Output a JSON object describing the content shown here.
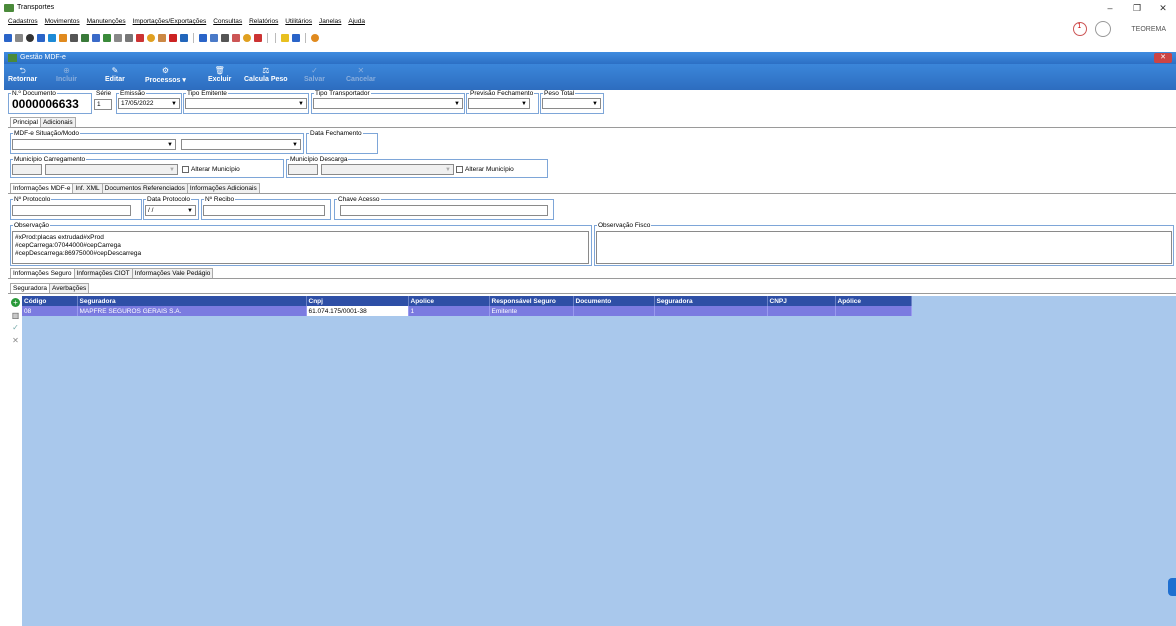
{
  "window": {
    "title": "Transportes",
    "min": "–",
    "restore": "❐",
    "close": "✕"
  },
  "menu": [
    "Cadastros",
    "Movimentos",
    "Manutenções",
    "Importações/Exportações",
    "Consultas",
    "Relatórios",
    "Utilitários",
    "Janelas",
    "Ajuda"
  ],
  "user": {
    "name": "TEOREMA",
    "notifications": "1"
  },
  "form": {
    "title": "Gestão MDF-e",
    "close": "✕",
    "commands": [
      {
        "label": "Retornar",
        "glyph": "⮌",
        "enabled": true
      },
      {
        "label": "Incluir",
        "glyph": "⊕",
        "enabled": false
      },
      {
        "label": "Editar",
        "glyph": "✎",
        "enabled": true
      },
      {
        "label": "Processos",
        "glyph": "⚙",
        "enabled": true
      },
      {
        "label": "Excluir",
        "glyph": "🗑",
        "enabled": true
      },
      {
        "label": "Calcula Peso",
        "glyph": "⚖",
        "enabled": true
      },
      {
        "label": "Salvar",
        "glyph": "✓",
        "enabled": false
      },
      {
        "label": "Cancelar",
        "glyph": "✕",
        "enabled": false
      }
    ]
  },
  "fields": {
    "num_doc_label": "N.º Documento",
    "num_doc": "0000006633",
    "serie_label": "Série",
    "serie": "1",
    "emissao_label": "Emissão",
    "emissao": "17/05/2022",
    "tipo_emitente_label": "Tipo Emitente",
    "tipo_transportador_label": "Tipo Transportador",
    "previsao_label": "Previsão Fechamento",
    "peso_label": "Peso Total"
  },
  "tabs_main": [
    "Principal",
    "Adicionais"
  ],
  "principal": {
    "situacao_label": "MDF-e Situação/Modo",
    "data_fechamento_label": "Data Fechamento",
    "mun_carregamento_label": "Município Carregamento",
    "mun_descarga_label": "Município Descarga",
    "alterar_municipio": "Alterar Município"
  },
  "tabs_info": [
    "Informações MDF-e",
    "Inf. XML",
    "Documentos Referenciados",
    "Informações Adicionais"
  ],
  "info": {
    "protocolo_label": "Nº Protocolo",
    "data_protocolo_label": "Data Protocolo",
    "data_protocolo": " / /",
    "recibo_label": "Nº Recibo",
    "chave_label": "Chave Acesso",
    "observacao_label": "Observação",
    "observacao_lines": [
      "#xProd:placas extrudad#xProd",
      "#cepCarrega:07044000#cepCarrega",
      "#cepDescarrega:86975000#cepDescarrega"
    ],
    "obs_fisco_label": "Observação Fisco"
  },
  "tabs_extra": [
    "Informações Seguro",
    "Informações CIOT",
    "Informações Vale Pedágio"
  ],
  "tabs_seguro": [
    "Seguradora",
    "Averbações"
  ],
  "grid": {
    "columns": [
      {
        "label": "Código"
      },
      {
        "label": "Seguradora"
      },
      {
        "label": "Cnpj"
      },
      {
        "label": "Apolice"
      },
      {
        "label": "Responsável Seguro"
      },
      {
        "label": "Documento"
      },
      {
        "label": "Seguradora"
      },
      {
        "label": "CNPJ"
      },
      {
        "label": "Apólice"
      }
    ],
    "rows": [
      [
        "08",
        "MAPFRE SEGUROS GERAIS S.A.",
        "61.074.175/0001-38",
        "1",
        "Emitente",
        "",
        "",
        "",
        ""
      ]
    ]
  }
}
